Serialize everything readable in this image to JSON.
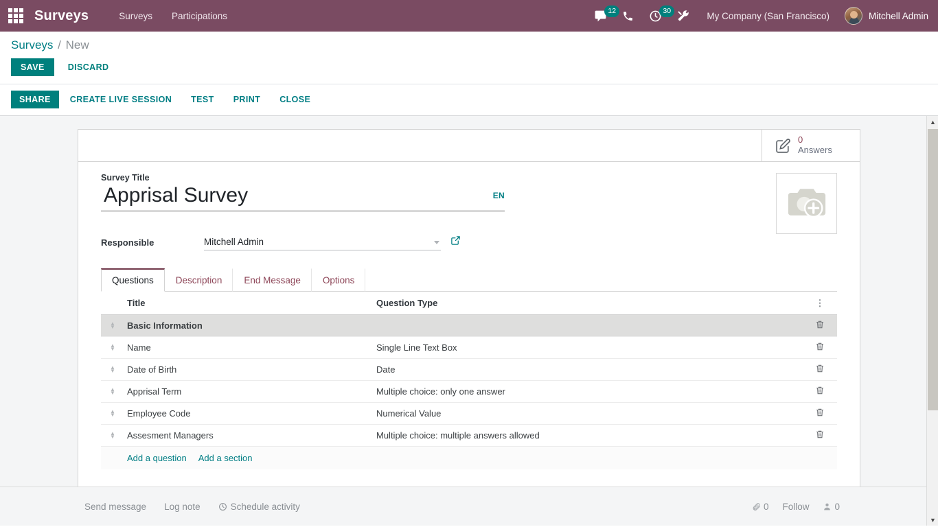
{
  "navbar": {
    "apps_icon": "apps-grid-icon",
    "brand": "Surveys",
    "menu": [
      {
        "label": "Surveys"
      },
      {
        "label": "Participations"
      }
    ],
    "tray": [
      {
        "icon": "messages-icon",
        "badge": "12"
      },
      {
        "icon": "phone-icon",
        "badge": ""
      },
      {
        "icon": "activities-clock-icon",
        "badge": "30"
      },
      {
        "icon": "debug-tools-icon",
        "badge": ""
      }
    ],
    "company": "My Company (San Francisco)",
    "user": "Mitchell Admin",
    "accent_color": "#7a4b62"
  },
  "control_panel": {
    "breadcrumb_root": "Surveys",
    "breadcrumb_sep": "/",
    "breadcrumb_current": "New",
    "save_label": "SAVE",
    "discard_label": "DISCARD"
  },
  "action_bar": {
    "buttons": [
      {
        "label": "SHARE",
        "primary": true
      },
      {
        "label": "CREATE LIVE SESSION",
        "primary": false
      },
      {
        "label": "TEST",
        "primary": false
      },
      {
        "label": "PRINT",
        "primary": false
      },
      {
        "label": "CLOSE",
        "primary": false
      }
    ],
    "accent_color": "#00807d"
  },
  "stat_button": {
    "icon": "edit-answers-icon",
    "value": "0",
    "label": "Answers",
    "value_color": "#8d4557"
  },
  "form": {
    "title_label": "Survey Title",
    "title_value": "Apprisal Survey",
    "title_placeholder": "e.g. Satisfaction Survey",
    "lang_badge": "EN",
    "responsible_label": "Responsible",
    "responsible_value": "Mitchell Admin",
    "responsible_placeholder": "",
    "image_placeholder_icon": "camera-add-icon"
  },
  "notebook": {
    "tabs": [
      {
        "label": "Questions",
        "active": true
      },
      {
        "label": "Description",
        "active": false
      },
      {
        "label": "End Message",
        "active": false
      },
      {
        "label": "Options",
        "active": false
      }
    ]
  },
  "questions_table": {
    "columns": [
      "Title",
      "Question Type"
    ],
    "optional_columns_icon": "vertical-dots-icon",
    "handle_icon": "drag-handle-icon",
    "trash_icon": "trash-icon",
    "rows": [
      {
        "kind": "section",
        "title": "Basic Information",
        "type": ""
      },
      {
        "kind": "question",
        "title": "Name",
        "type": "Single Line Text Box"
      },
      {
        "kind": "question",
        "title": "Date of Birth",
        "type": "Date"
      },
      {
        "kind": "question",
        "title": "Apprisal Term",
        "type": "Multiple choice: only one answer"
      },
      {
        "kind": "question",
        "title": "Employee Code",
        "type": "Numerical Value"
      },
      {
        "kind": "question",
        "title": "Assesment Managers",
        "type": "Multiple choice: multiple answers allowed"
      }
    ],
    "add_question_label": "Add a question",
    "add_section_label": "Add a section"
  },
  "chatter": {
    "send_message": "Send message",
    "log_note": "Log note",
    "schedule_activity": "Schedule activity",
    "schedule_icon": "clock-icon",
    "attachment_icon": "paperclip-icon",
    "attachment_count": "0",
    "follow_label": "Follow",
    "followers_icon": "user-icon",
    "followers_count": "0"
  }
}
